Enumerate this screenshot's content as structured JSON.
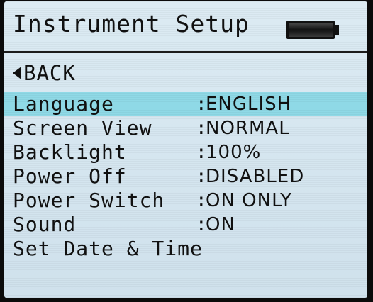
{
  "header": {
    "title": "Instrument Setup",
    "battery_icon": "battery-full-icon"
  },
  "nav": {
    "back_label": "BACK",
    "back_icon": "triangle-left-icon"
  },
  "menu": {
    "selected_index": 0,
    "items": [
      {
        "label": "Language",
        "separator": ":",
        "value": "ENGLISH"
      },
      {
        "label": "Screen View",
        "separator": ":",
        "value": "NORMAL"
      },
      {
        "label": "Backlight",
        "separator": ":",
        "value": "100%"
      },
      {
        "label": "Power Off",
        "separator": ":",
        "value": "DISABLED"
      },
      {
        "label": "Power Switch",
        "separator": ":",
        "value": "ON ONLY"
      },
      {
        "label": "Sound",
        "separator": ":",
        "value": "ON"
      },
      {
        "label": "Set Date & Time"
      }
    ]
  },
  "colors": {
    "screen_background": "#d6e7f0",
    "selection_highlight": "#8fd9e6",
    "text": "#111111",
    "bezel": "#0b0b0b"
  }
}
